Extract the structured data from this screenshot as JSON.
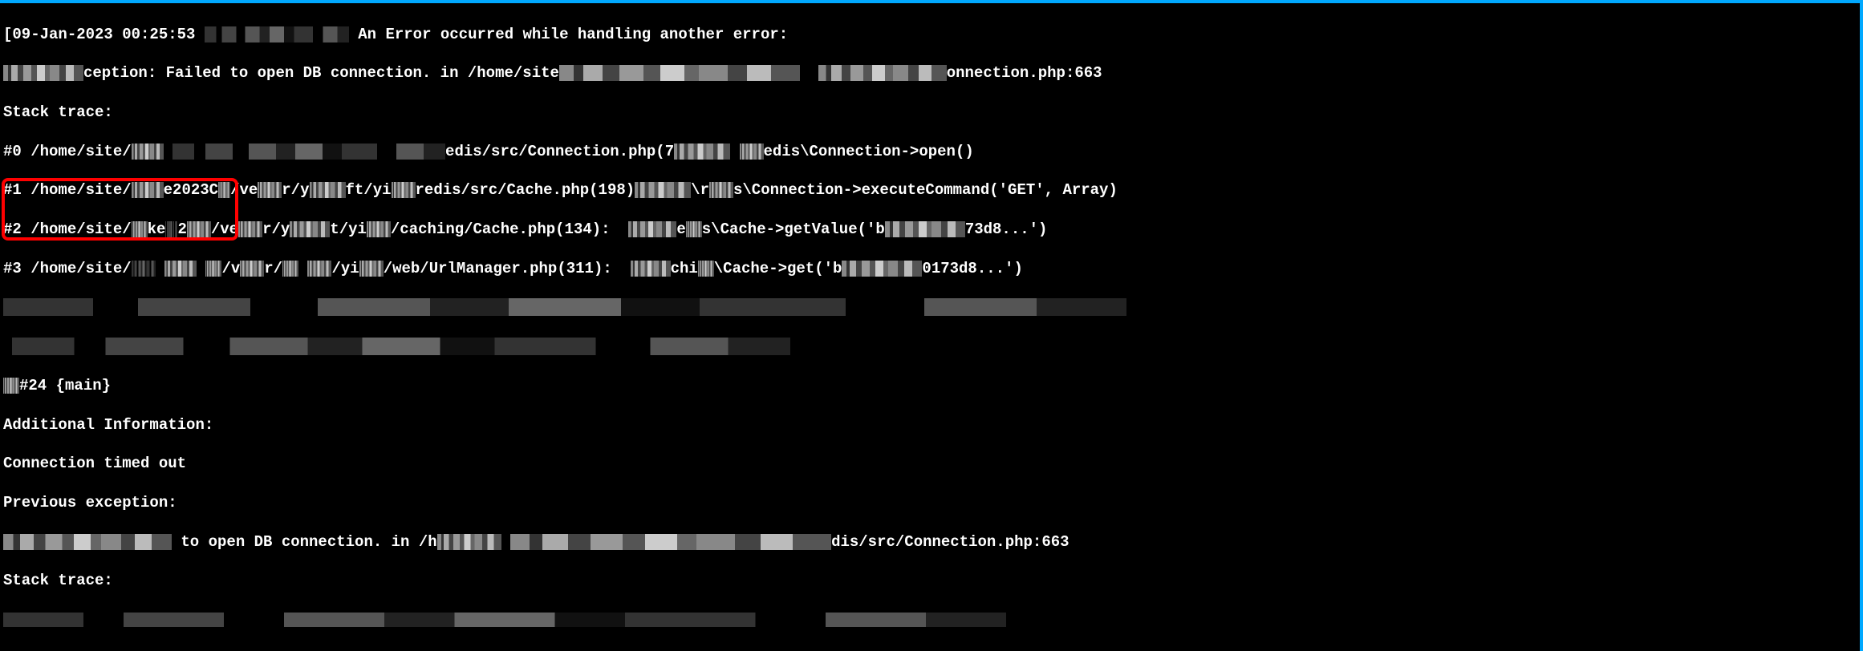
{
  "terminal": {
    "timestamp": "[09-Jan-2023 00:25:53",
    "errorHeader": "An Error occurred while handling another error:",
    "line2_prefix": "",
    "line2_exception": "ception: Failed to open DB connection. in /home/site",
    "line2_suffix": "onnection.php:663",
    "stackTrace": "Stack trace:",
    "stack0_prefix": "#0 /home/site/",
    "stack0_mid": "edis/src/Connection.php(7",
    "stack0_suffix": "edis\\Connection->open()",
    "stack1_prefix": "#1 /home/site/",
    "stack1_a": "e2023C",
    "stack1_b": "/ve",
    "stack1_c": "r/y",
    "stack1_d": "ft/yi",
    "stack1_e": "redis/src/Cache.php(198)",
    "stack1_f": "\\r",
    "stack1_g": "s\\Connection->executeCommand('GET', Array)",
    "stack2_prefix": "#2 /home/site/",
    "stack2_a": "ke",
    "stack2_a2": "2",
    "stack2_b": "/ve",
    "stack2_c": "r/y",
    "stack2_d": "t/yi",
    "stack2_e": "/caching/Cache.php(134):",
    "stack2_f": "e",
    "stack2_g": "s\\Cache->getValue('b",
    "stack2_h": "73d8...')",
    "stack3_prefix": "#3 /home/site/",
    "stack3_b": "/v",
    "stack3_c": "r/",
    "stack3_d": "/yi",
    "stack3_e": "/web/UrlManager.php(311):",
    "stack3_f": "chi",
    "stack3_g": "\\Cache->get('b",
    "stack3_h": "0173d8...')",
    "main": "#24 {main}",
    "additionalInfo": "Additional Information:",
    "connectionTimeout": "Connection timed out",
    "previousException": "Previous exception:",
    "bottom_mid": "to open DB connection. in /h",
    "bottom_suffix": "dis/src/Connection.php:663",
    "stackTrace2": "Stack trace:"
  }
}
